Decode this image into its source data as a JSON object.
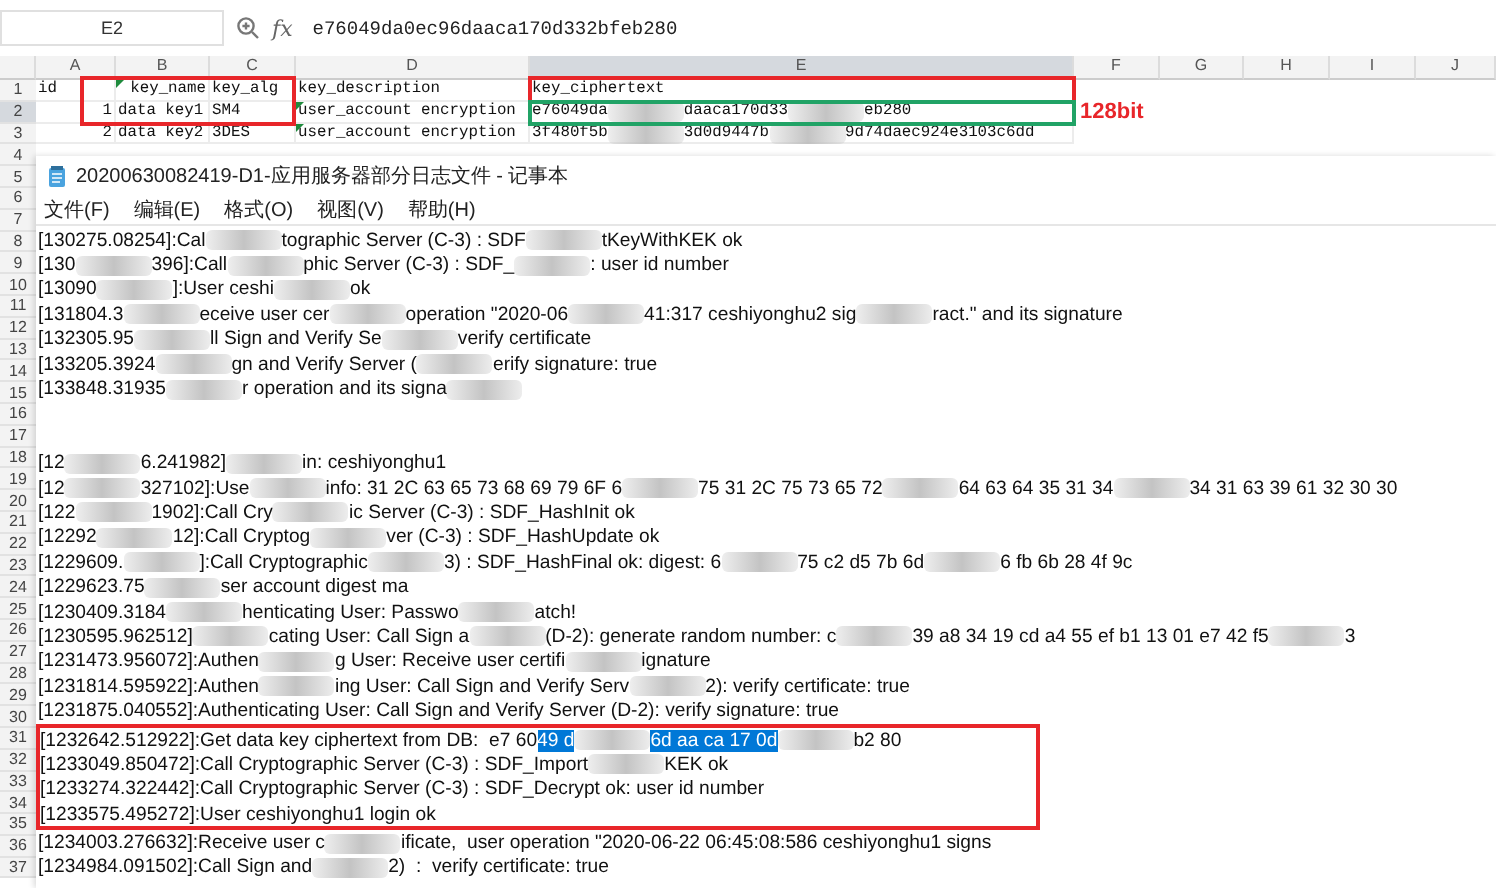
{
  "formula_bar": {
    "cell_name": "E2",
    "function_label": "fx",
    "value": "e76049da0ec96daaca170d332bfeb280"
  },
  "sheet": {
    "columns": [
      {
        "label": "A",
        "selected": false
      },
      {
        "label": "B",
        "selected": false
      },
      {
        "label": "C",
        "selected": false
      },
      {
        "label": "D",
        "selected": false
      },
      {
        "label": "E",
        "selected": true
      },
      {
        "label": "F",
        "selected": false
      },
      {
        "label": "G",
        "selected": false
      },
      {
        "label": "H",
        "selected": false
      },
      {
        "label": "I",
        "selected": false
      },
      {
        "label": "J",
        "selected": false
      }
    ],
    "rows": [
      {
        "header": "1",
        "selected": false,
        "cells": [
          {
            "kind": "left",
            "flag": false,
            "segments": [
              {
                "kind": "plain",
                "text": "id"
              }
            ]
          },
          {
            "kind": "right",
            "flag": true,
            "segments": [
              {
                "kind": "plain",
                "text": "key_name"
              }
            ]
          },
          {
            "kind": "left",
            "flag": false,
            "segments": [
              {
                "kind": "plain",
                "text": "key_alg"
              }
            ]
          },
          {
            "kind": "left",
            "flag": false,
            "segments": [
              {
                "kind": "plain",
                "text": "key_description"
              }
            ]
          },
          {
            "kind": "left",
            "flag": false,
            "selected": false,
            "segments": [
              {
                "kind": "plain",
                "text": "key_ciphertext"
              }
            ]
          }
        ]
      },
      {
        "header": "2",
        "selected": true,
        "cells": [
          {
            "kind": "right",
            "flag": false,
            "segments": [
              {
                "kind": "plain",
                "text": "1"
              }
            ]
          },
          {
            "kind": "left",
            "flag": false,
            "segments": [
              {
                "kind": "plain",
                "text": "data key1"
              }
            ]
          },
          {
            "kind": "left",
            "flag": false,
            "segments": [
              {
                "kind": "plain",
                "text": "SM4"
              }
            ]
          },
          {
            "kind": "left",
            "flag": true,
            "segments": [
              {
                "kind": "plain",
                "text": "user_account encryption"
              }
            ]
          },
          {
            "kind": "left",
            "flag": false,
            "selected": true,
            "segments": [
              {
                "kind": "plain",
                "text": "e76049da"
              },
              {
                "kind": "blur"
              },
              {
                "kind": "plain",
                "text": "daaca170d33"
              },
              {
                "kind": "blur"
              },
              {
                "kind": "plain",
                "text": "eb280"
              }
            ]
          }
        ]
      },
      {
        "header": "3",
        "selected": false,
        "cells": [
          {
            "kind": "right",
            "flag": false,
            "segments": [
              {
                "kind": "plain",
                "text": "2"
              }
            ]
          },
          {
            "kind": "left",
            "flag": false,
            "segments": [
              {
                "kind": "plain",
                "text": "data key2"
              }
            ]
          },
          {
            "kind": "left",
            "flag": false,
            "segments": [
              {
                "kind": "plain",
                "text": "3DES"
              }
            ]
          },
          {
            "kind": "left",
            "flag": true,
            "segments": [
              {
                "kind": "plain",
                "text": "user_account encryption"
              }
            ]
          },
          {
            "kind": "left",
            "flag": false,
            "selected": false,
            "segments": [
              {
                "kind": "plain",
                "text": "3f480f5b"
              },
              {
                "kind": "blur"
              },
              {
                "kind": "plain",
                "text": "3d0d9447b"
              },
              {
                "kind": "blur"
              },
              {
                "kind": "plain",
                "text": "9d74daec924e3103c6dd"
              }
            ]
          }
        ]
      }
    ],
    "more_row_headers": [
      "4",
      "5",
      "6",
      "7",
      "8",
      "9",
      "10",
      "11",
      "12",
      "13",
      "14",
      "15",
      "16",
      "17",
      "18",
      "19",
      "20",
      "21",
      "22",
      "23",
      "24",
      "25",
      "26",
      "27",
      "28",
      "29",
      "30",
      "31",
      "32",
      "33",
      "34",
      "35",
      "36",
      "37"
    ]
  },
  "annotations": [
    {
      "kind": "box"
    },
    {
      "kind": "box"
    },
    {
      "kind": "label",
      "text": "128bit"
    }
  ],
  "notepad": {
    "title": "20200630082419-D1-应用服务器部分日志文件 - 记事本",
    "menu": [
      "文件(F)",
      "编辑(E)",
      "格式(O)",
      "视图(V)",
      "帮助(H)"
    ],
    "lines": [
      {
        "marked": false,
        "segments": [
          {
            "kind": "plain",
            "text": "[130275.08254]:Cal"
          },
          {
            "kind": "blur"
          },
          {
            "kind": "plain",
            "text": "tographic Server (C-3) : SDF"
          },
          {
            "kind": "blur"
          },
          {
            "kind": "plain",
            "text": "tKeyWithKEK ok"
          }
        ]
      },
      {
        "marked": false,
        "segments": [
          {
            "kind": "plain",
            "text": "[130"
          },
          {
            "kind": "blur"
          },
          {
            "kind": "plain",
            "text": "396]:Call"
          },
          {
            "kind": "blur"
          },
          {
            "kind": "plain",
            "text": "phic Server (C-3) : SDF_"
          },
          {
            "kind": "blur"
          },
          {
            "kind": "plain",
            "text": ": user id number"
          }
        ]
      },
      {
        "marked": false,
        "segments": [
          {
            "kind": "plain",
            "text": "[13090"
          },
          {
            "kind": "blur"
          },
          {
            "kind": "plain",
            "text": "]:User ceshi"
          },
          {
            "kind": "blur"
          },
          {
            "kind": "plain",
            "text": "ok"
          }
        ]
      },
      {
        "marked": false,
        "segments": [
          {
            "kind": "plain",
            "text": "[131804.3"
          },
          {
            "kind": "blur"
          },
          {
            "kind": "plain",
            "text": "eceive user cer"
          },
          {
            "kind": "blur"
          },
          {
            "kind": "plain",
            "text": "operation \"2020-06"
          },
          {
            "kind": "blur"
          },
          {
            "kind": "plain",
            "text": "41:317 ceshiyonghu2 sig"
          },
          {
            "kind": "blur"
          },
          {
            "kind": "plain",
            "text": "ract.\" and its signature"
          }
        ]
      },
      {
        "marked": false,
        "segments": [
          {
            "kind": "plain",
            "text": "[132305.95"
          },
          {
            "kind": "blur"
          },
          {
            "kind": "plain",
            "text": "ll Sign and Verify Se"
          },
          {
            "kind": "blur"
          },
          {
            "kind": "plain",
            "text": "verify certificate"
          }
        ]
      },
      {
        "marked": false,
        "segments": [
          {
            "kind": "plain",
            "text": "[133205.3924"
          },
          {
            "kind": "blur"
          },
          {
            "kind": "plain",
            "text": "gn and Verify Server ("
          },
          {
            "kind": "blur"
          },
          {
            "kind": "plain",
            "text": "erify signature: true"
          }
        ]
      },
      {
        "marked": false,
        "segments": [
          {
            "kind": "plain",
            "text": "[133848.31935"
          },
          {
            "kind": "blur"
          },
          {
            "kind": "plain",
            "text": "r operation and its signa"
          },
          {
            "kind": "blur"
          }
        ]
      },
      {
        "marked": false
      },
      {
        "marked": false
      },
      {
        "marked": false,
        "segments": [
          {
            "kind": "plain",
            "text": "[12"
          },
          {
            "kind": "blur"
          },
          {
            "kind": "plain",
            "text": "6.241982]"
          },
          {
            "kind": "blur"
          },
          {
            "kind": "plain",
            "text": "in: ceshiyonghu1"
          }
        ]
      },
      {
        "marked": false,
        "segments": [
          {
            "kind": "plain",
            "text": "[12"
          },
          {
            "kind": "blur"
          },
          {
            "kind": "plain",
            "text": "327102]:Use"
          },
          {
            "kind": "blur"
          },
          {
            "kind": "plain",
            "text": "info: 31 2C 63 65 73 68 69 79 6F 6"
          },
          {
            "kind": "blur"
          },
          {
            "kind": "plain",
            "text": "75 31 2C 75 73 65 72"
          },
          {
            "kind": "blur"
          },
          {
            "kind": "plain",
            "text": "64 63 64 35 31 34"
          },
          {
            "kind": "blur"
          },
          {
            "kind": "plain",
            "text": "34 31 63 39 61 32 30 30"
          }
        ]
      },
      {
        "marked": false,
        "segments": [
          {
            "kind": "plain",
            "text": "[122"
          },
          {
            "kind": "blur"
          },
          {
            "kind": "plain",
            "text": "1902]:Call Cry"
          },
          {
            "kind": "blur"
          },
          {
            "kind": "plain",
            "text": "ic Server (C-3) : SDF_HashInit ok"
          }
        ]
      },
      {
        "marked": false,
        "segments": [
          {
            "kind": "plain",
            "text": "[12292"
          },
          {
            "kind": "blur"
          },
          {
            "kind": "plain",
            "text": "12]:Call Cryptog"
          },
          {
            "kind": "blur"
          },
          {
            "kind": "plain",
            "text": "ver (C-3) : SDF_HashUpdate ok"
          }
        ]
      },
      {
        "marked": false,
        "segments": [
          {
            "kind": "plain",
            "text": "[1229609."
          },
          {
            "kind": "blur"
          },
          {
            "kind": "plain",
            "text": "]:Call Cryptographic"
          },
          {
            "kind": "blur"
          },
          {
            "kind": "plain",
            "text": "3) : SDF_HashFinal ok: digest: 6"
          },
          {
            "kind": "blur"
          },
          {
            "kind": "plain",
            "text": "75 c2 d5 7b 6d"
          },
          {
            "kind": "blur"
          },
          {
            "kind": "plain",
            "text": "6 fb 6b 28 4f 9c"
          }
        ]
      },
      {
        "marked": false,
        "segments": [
          {
            "kind": "plain",
            "text": "[1229623.75"
          },
          {
            "kind": "blur"
          },
          {
            "kind": "plain",
            "text": "ser account digest ma"
          }
        ]
      },
      {
        "marked": false,
        "segments": [
          {
            "kind": "plain",
            "text": "[1230409.3184"
          },
          {
            "kind": "blur"
          },
          {
            "kind": "plain",
            "text": "henticating User: Passwo"
          },
          {
            "kind": "blur"
          },
          {
            "kind": "plain",
            "text": "atch!"
          }
        ]
      },
      {
        "marked": false,
        "segments": [
          {
            "kind": "plain",
            "text": "[1230595.962512]"
          },
          {
            "kind": "blur"
          },
          {
            "kind": "plain",
            "text": "cating User: Call Sign a"
          },
          {
            "kind": "blur"
          },
          {
            "kind": "plain",
            "text": "(D-2): generate random number: c"
          },
          {
            "kind": "blur"
          },
          {
            "kind": "plain",
            "text": "39 a8 34 19 cd a4 55 ef b1 13 01 e7 42 f5"
          },
          {
            "kind": "blur"
          },
          {
            "kind": "plain",
            "text": "3"
          }
        ]
      },
      {
        "marked": false,
        "segments": [
          {
            "kind": "plain",
            "text": "[1231473.956072]:Authen"
          },
          {
            "kind": "blur"
          },
          {
            "kind": "plain",
            "text": "g User: Receive user certifi"
          },
          {
            "kind": "blur"
          },
          {
            "kind": "plain",
            "text": "ignature"
          }
        ]
      },
      {
        "marked": false,
        "segments": [
          {
            "kind": "plain",
            "text": "[1231814.595922]:Authen"
          },
          {
            "kind": "blur"
          },
          {
            "kind": "plain",
            "text": "ing User: Call Sign and Verify Serv"
          },
          {
            "kind": "blur"
          },
          {
            "kind": "plain",
            "text": "2): verify certificate: true"
          }
        ]
      },
      {
        "marked": false,
        "segments": [
          {
            "kind": "plain",
            "text": "[1231875.040552]:Authenticating User: Call Sign and Verify Server (D-2): verify signature: true"
          }
        ]
      },
      {
        "marked": true,
        "segments": [
          {
            "kind": "plain",
            "text": "[1232642.512922]:Get data key ciphertext from DB:  e7 60"
          },
          {
            "kind": "selected",
            "text": "49 d"
          },
          {
            "kind": "blur"
          },
          {
            "kind": "selected",
            "text": "6d aa ca 17 0d"
          },
          {
            "kind": "blur"
          },
          {
            "kind": "plain",
            "text": "b2 80"
          }
        ]
      },
      {
        "marked": true,
        "segments": [
          {
            "kind": "plain",
            "text": "[1233049.850472]:Call Cryptographic Server (C-3) : SDF_Import"
          },
          {
            "kind": "blur"
          },
          {
            "kind": "plain",
            "text": "KEK ok"
          }
        ]
      },
      {
        "marked": true,
        "segments": [
          {
            "kind": "plain",
            "text": "[1233274.322442]:Call Cryptographic Server (C-3) : SDF_Decrypt ok: user id number"
          }
        ]
      },
      {
        "marked": true,
        "segments": [
          {
            "kind": "plain",
            "text": "[1233575.495272]:User ceshiyonghu1 login ok"
          }
        ]
      },
      {
        "marked": false,
        "segments": [
          {
            "kind": "plain",
            "text": "[1234003.276632]:Receive user c"
          },
          {
            "kind": "blur"
          },
          {
            "kind": "plain",
            "text": "ificate,  user operation \"2020-06-22 06:45:08:586 ceshiyonghu1 signs"
          }
        ]
      },
      {
        "marked": false,
        "segments": [
          {
            "kind": "plain",
            "text": "[1234984.091502]:Call Sign and"
          },
          {
            "kind": "blur"
          },
          {
            "kind": "plain",
            "text": "2)  :  verify certificate: true"
          }
        ]
      }
    ]
  }
}
